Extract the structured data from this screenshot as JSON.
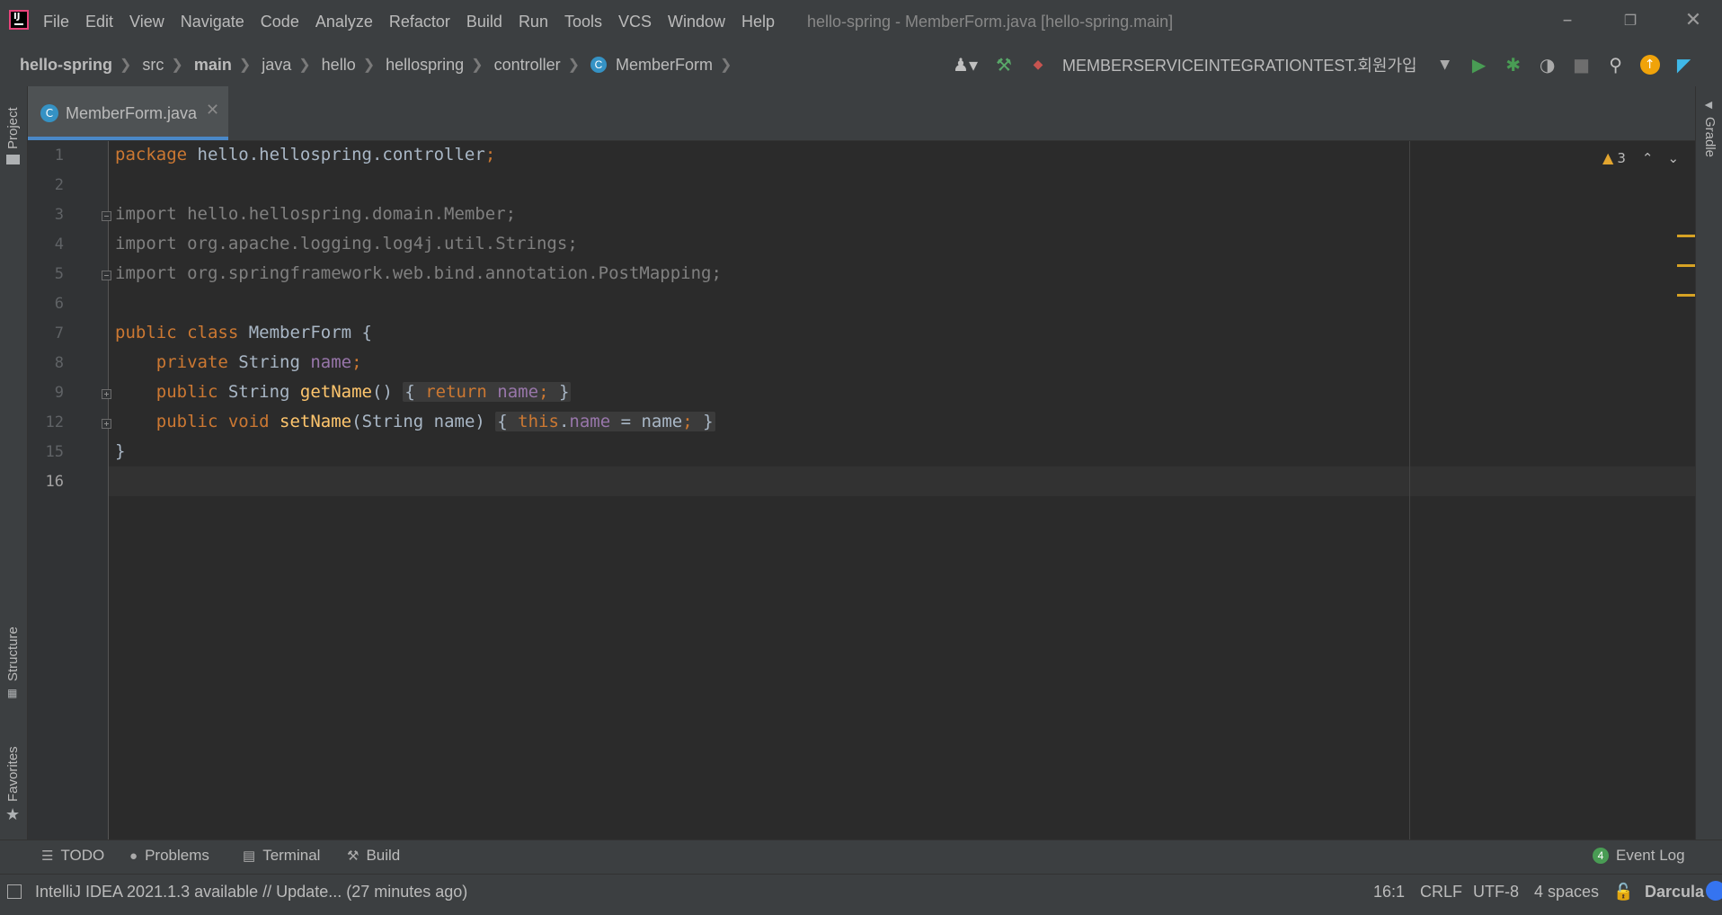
{
  "menu": [
    "File",
    "Edit",
    "View",
    "Navigate",
    "Code",
    "Analyze",
    "Refactor",
    "Build",
    "Run",
    "Tools",
    "VCS",
    "Window",
    "Help"
  ],
  "window_title": "hello-spring - MemberForm.java [hello-spring.main]",
  "breadcrumb": [
    "hello-spring",
    "src",
    "main",
    "java",
    "hello",
    "hellospring",
    "controller",
    "MemberForm"
  ],
  "run_config": "MEMBERSERVICEINTEGRATIONTEST.회원가입",
  "tab": {
    "label": "MemberForm.java"
  },
  "left_tabs": {
    "project": "Project",
    "structure": "Structure",
    "favorites": "Favorites"
  },
  "right_tabs": {
    "gradle": "Gradle"
  },
  "warnings_count": "3",
  "line_numbers": [
    "1",
    "2",
    "3",
    "4",
    "5",
    "6",
    "7",
    "8",
    "9",
    "12",
    "15",
    "16"
  ],
  "code": {
    "l1_kw": "package",
    "l1_rest": " hello.hellospring.controller",
    "l1_semi": ";",
    "l3": "import hello.hellospring.domain.Member;",
    "l4": "import org.apache.logging.log4j.util.Strings;",
    "l5": "import org.springframework.web.bind.annotation.PostMapping;",
    "l7_kw": "public class",
    "l7_rest": " MemberForm {",
    "l8_kw": "private",
    "l8_type": " String ",
    "l8_field": "name",
    "l8_semi": ";",
    "l9_kw": "public",
    "l9_type": " String ",
    "l9_method": "getName",
    "l9_paren": "() ",
    "l9_fold_open": "{ ",
    "l9_ret": "return",
    "l9_field": " name",
    "l9_semi": ";",
    "l9_fold_close": " }",
    "l12_kw": "public void",
    "l12_method": " setName",
    "l12_params": "(String name) ",
    "l12_fold_open": "{ ",
    "l12_this": "this",
    "l12_dot": ".",
    "l12_field": "name",
    "l12_assign": " = name",
    "l12_semi": ";",
    "l12_fold_close": " }",
    "l15": "}"
  },
  "bottom_tabs": {
    "todo": "TODO",
    "problems": "Problems",
    "terminal": "Terminal",
    "build": "Build",
    "event_log": "Event Log",
    "event_count": "4"
  },
  "status": {
    "message": "IntelliJ IDEA 2021.1.3 available // Update... (27 minutes ago)",
    "position": "16:1",
    "line_sep": "CRLF",
    "encoding": "UTF-8",
    "indent": "4 spaces",
    "theme": "Darcula"
  }
}
